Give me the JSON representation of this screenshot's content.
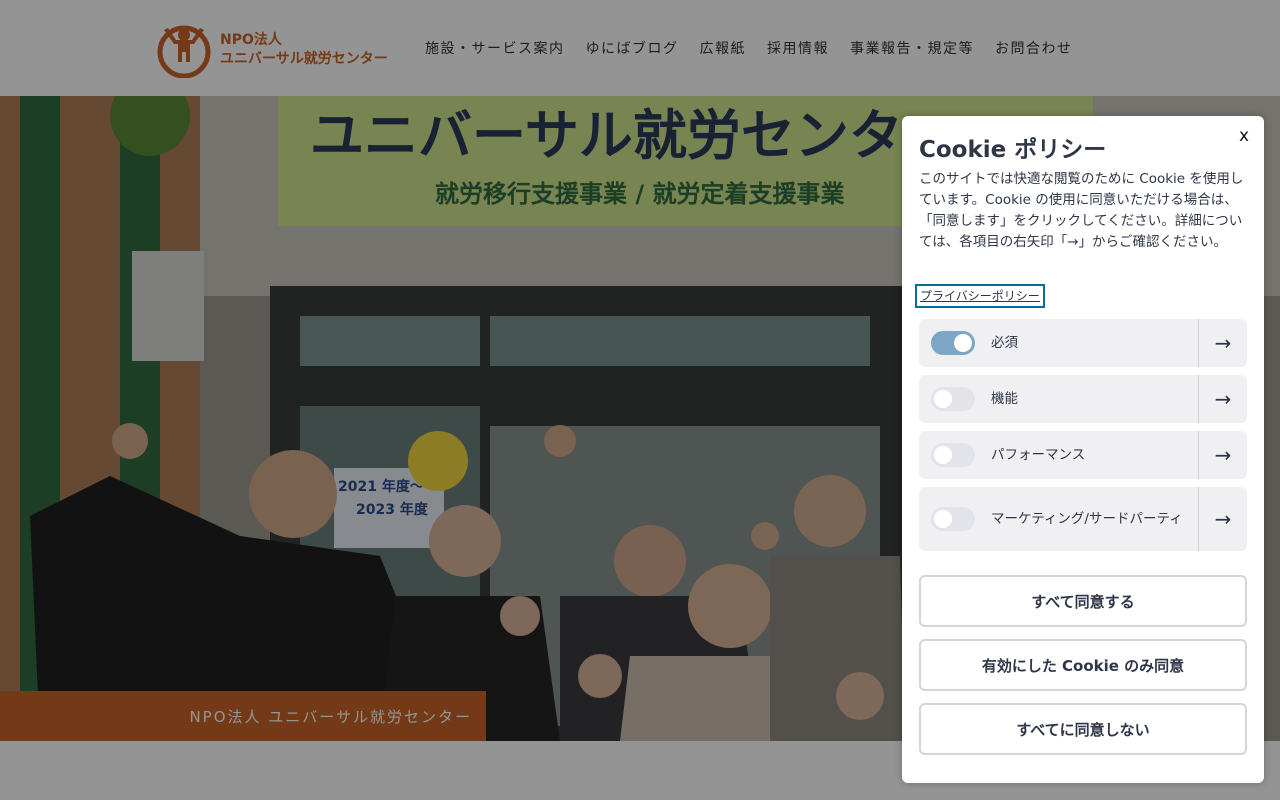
{
  "header": {
    "logo_line1": "NPO法人",
    "logo_line2": "ユニバーサル就労センター",
    "nav": [
      "施設・サービス案内",
      "ゆにばブログ",
      "広報紙",
      "採用情報",
      "事業報告・規定等",
      "お問合わせ"
    ]
  },
  "hero": {
    "sign_main": "ユニバーサル就労センター",
    "sign_sub": "就労移行支援事業 / 就労定着支援事業",
    "poster_text_1": "2021 年度～",
    "poster_text_2": "2023 年度",
    "band_text": "NPO法人 ユニバーサル就労センター"
  },
  "cookie": {
    "title": "Cookie ポリシー",
    "close_label": "x",
    "description": "このサイトでは快適な閲覧のために Cookie を使用しています。Cookie の使用に同意いただける場合は、「同意します」をクリックしてください。詳細については、各項目の右矢印「→」からご確認ください。",
    "privacy_link": "プライバシーポリシー",
    "categories": [
      {
        "label": "必須",
        "enabled": true,
        "arrow": "→"
      },
      {
        "label": "機能",
        "enabled": false,
        "arrow": "→"
      },
      {
        "label": "パフォーマンス",
        "enabled": false,
        "arrow": "→"
      },
      {
        "label": "マーケティング/サードパーティ",
        "enabled": false,
        "arrow": "→"
      }
    ],
    "buttons": {
      "accept_all": "すべて同意する",
      "accept_selected": "有効にした Cookie のみ同意",
      "reject_all": "すべてに同意しない"
    }
  },
  "colors": {
    "brand_orange": "#c8642a",
    "toggle_on": "#7da6c5",
    "text_dark": "#2e3648",
    "link_focus": "#0b6b9c"
  },
  "icons": {
    "logo": "person-raising-arms-icon",
    "category_arrow": "arrow-right-icon",
    "close": "close-icon"
  }
}
